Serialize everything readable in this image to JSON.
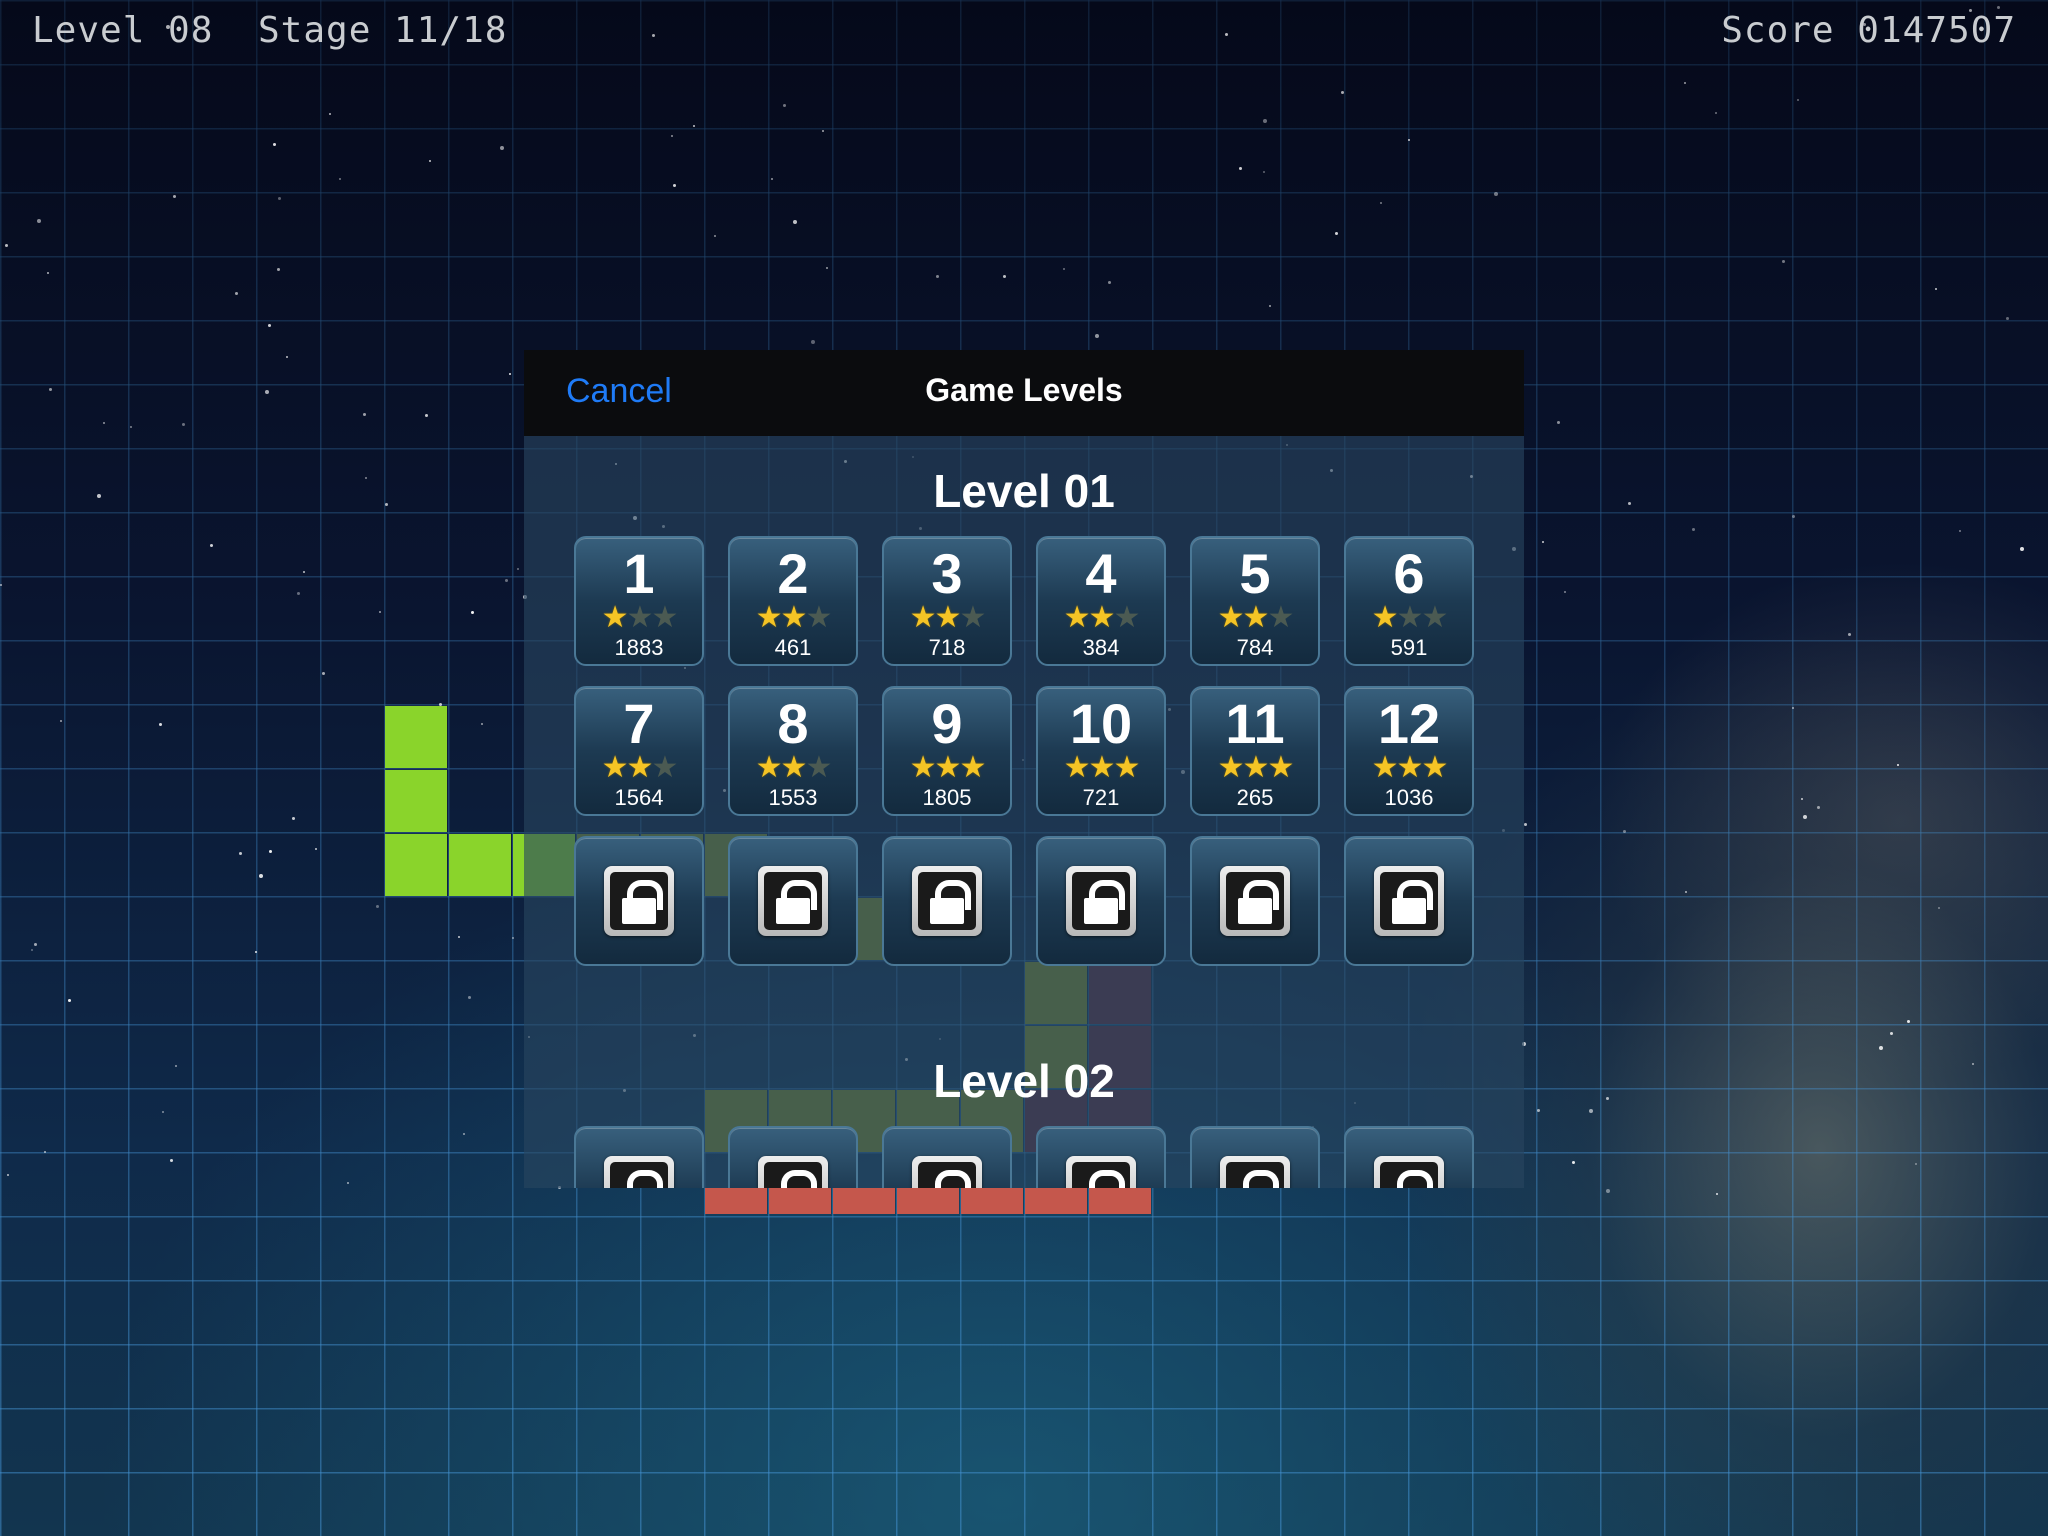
{
  "hud": {
    "level": "Level 08",
    "stage": "Stage 11/18",
    "score": "Score 0147507"
  },
  "dialog": {
    "cancel_label": "Cancel",
    "title": "Game Levels"
  },
  "sections": [
    {
      "title": "Level 01",
      "stages": [
        {
          "number": "1",
          "stars": 1,
          "score": "1883"
        },
        {
          "number": "2",
          "stars": 2,
          "score": "461"
        },
        {
          "number": "3",
          "stars": 2,
          "score": "718"
        },
        {
          "number": "4",
          "stars": 2,
          "score": "384"
        },
        {
          "number": "5",
          "stars": 2,
          "score": "784"
        },
        {
          "number": "6",
          "stars": 1,
          "score": "591"
        },
        {
          "number": "7",
          "stars": 2,
          "score": "1564"
        },
        {
          "number": "8",
          "stars": 2,
          "score": "1553"
        },
        {
          "number": "9",
          "stars": 3,
          "score": "1805"
        },
        {
          "number": "10",
          "stars": 3,
          "score": "721"
        },
        {
          "number": "11",
          "stars": 3,
          "score": "265"
        },
        {
          "number": "12",
          "stars": 3,
          "score": "1036"
        }
      ],
      "locked_count": 6
    },
    {
      "title": "Level 02",
      "stages": [],
      "locked_count": 6
    }
  ],
  "colors": {
    "accent": "#1f7bf6",
    "star_on": "#f5c425",
    "star_off": "#4b5a52",
    "piece_green": "#8ad42b",
    "piece_red": "#c5574c"
  },
  "icons": [
    "star-icon",
    "lock-icon"
  ]
}
